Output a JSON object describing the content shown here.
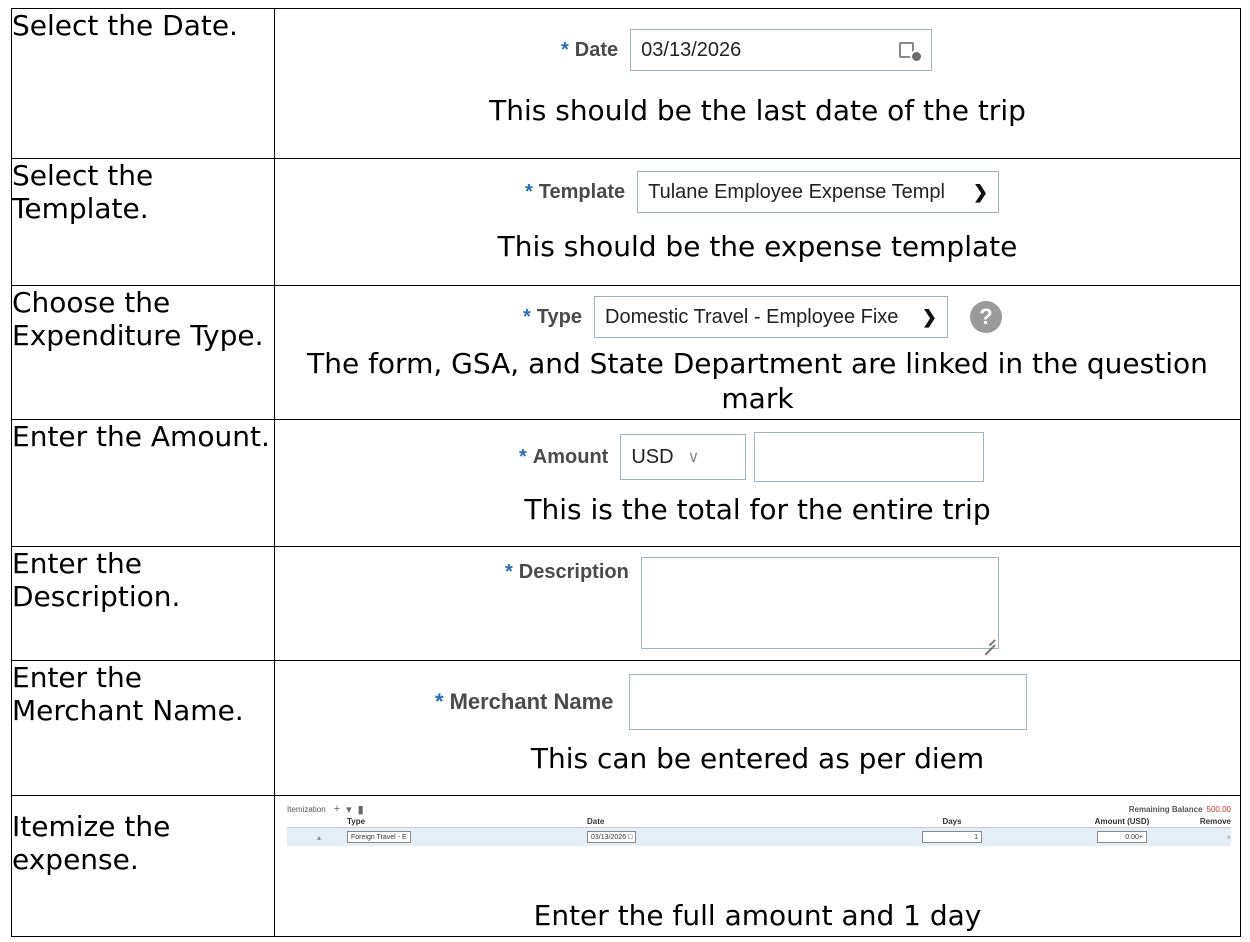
{
  "rows": [
    {
      "instruction": "Select the Date.",
      "label": "Date",
      "value": "03/13/2026",
      "note": "This should be the last date of the trip"
    },
    {
      "instruction": "Select the Template.",
      "label": "Template",
      "value": "Tulane Employee Expense Templ",
      "note": "This should be the expense template"
    },
    {
      "instruction": "Choose the Expenditure Type.",
      "label": "Type",
      "value": "Domestic Travel - Employee Fixe",
      "note": "The form, GSA, and State Department are linked in the question mark"
    },
    {
      "instruction": "Enter the Amount.",
      "label": "Amount",
      "currency": "USD",
      "value": "",
      "note": "This is the total for the entire trip"
    },
    {
      "instruction": "Enter the Description.",
      "label": "Description",
      "value": ""
    },
    {
      "instruction": "Enter the Merchant Name.",
      "label": "Merchant Name",
      "value": "",
      "note": "This can be entered as per diem"
    },
    {
      "instruction": "Itemize the expense.",
      "note": "Enter the full amount and 1 day"
    }
  ],
  "required_marker": "*",
  "help_symbol": "?",
  "itemization": {
    "title": "Itemization",
    "remaining_balance_label": "Remaining Balance",
    "remaining_balance_value": "500.00",
    "headers": {
      "type": "Type",
      "date": "Date",
      "days": "Days",
      "amount": "Amount (USD)",
      "remove": "Remove"
    },
    "row": {
      "type": "Foreign Travel - E",
      "date": "03/13/2026",
      "days": "1",
      "amount": "0.00+",
      "remove": "×"
    }
  }
}
